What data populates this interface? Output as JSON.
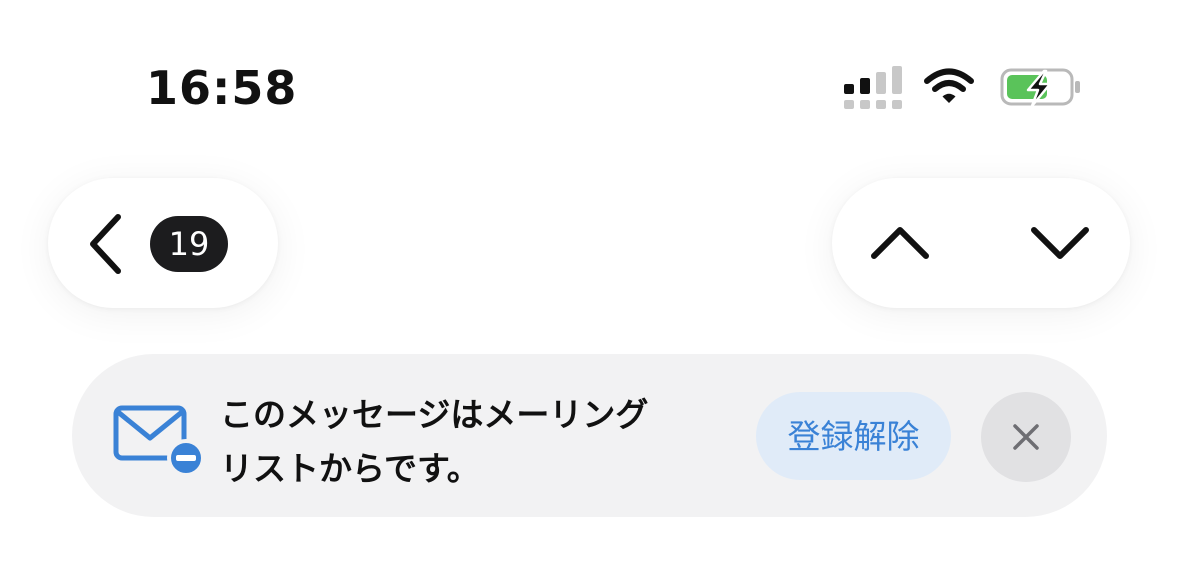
{
  "status_bar": {
    "time": "16:58",
    "icons": [
      "signal-icon",
      "wifi-icon",
      "battery-charging-icon"
    ],
    "battery_color": "#5ac35a"
  },
  "navigation": {
    "back_icon": "chevron-left-icon",
    "message_count": "19",
    "previous_icon": "chevron-up-icon",
    "next_icon": "chevron-down-icon"
  },
  "banner": {
    "icon": "envelope-minus-icon",
    "message_line1": "このメッセージはメーリング",
    "message_line2": "リストからです。",
    "unsubscribe_label": "登録解除",
    "close_icon": "close-icon",
    "accent_color": "#3a82d6"
  }
}
